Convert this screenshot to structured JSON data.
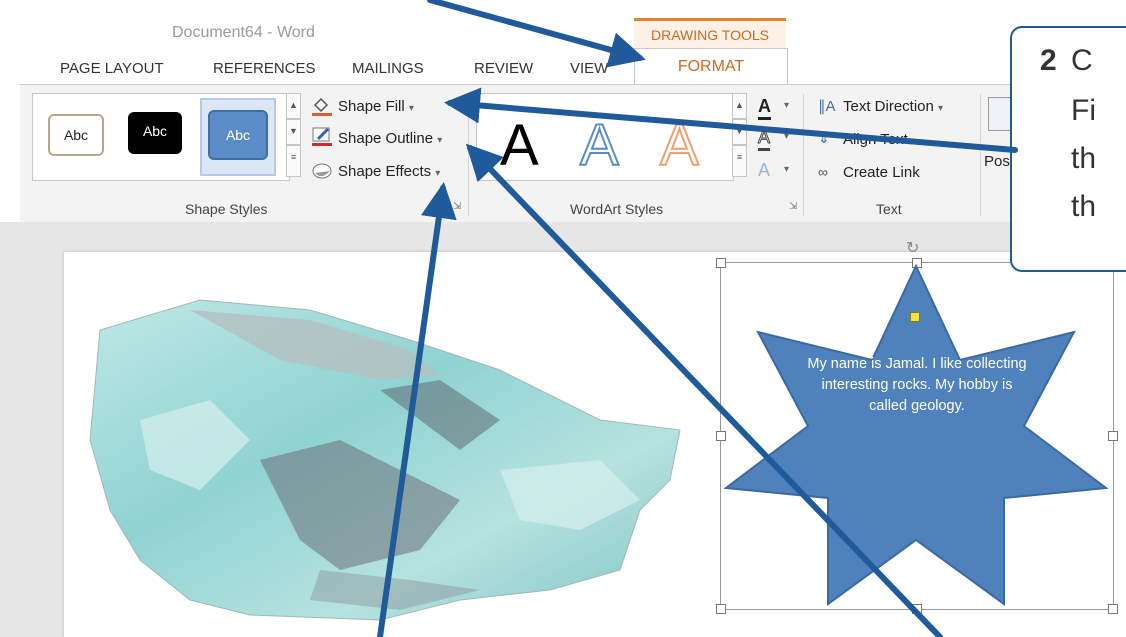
{
  "window": {
    "title": "Document64 - Word"
  },
  "contextual_tab": {
    "label": "DRAWING TOOLS"
  },
  "tabs": [
    {
      "label": "PAGE LAYOUT"
    },
    {
      "label": "REFERENCES"
    },
    {
      "label": "MAILINGS"
    },
    {
      "label": "REVIEW"
    },
    {
      "label": "VIEW"
    },
    {
      "label": "FORMAT"
    }
  ],
  "shape_styles": {
    "gallery": [
      {
        "label": "Abc",
        "style": "outline"
      },
      {
        "label": "Abc",
        "style": "black"
      },
      {
        "label": "Abc",
        "style": "blue-selected"
      }
    ],
    "shape_fill": "Shape Fill",
    "shape_outline": "Shape Outline",
    "shape_effects": "Shape Effects",
    "group_label": "Shape Styles"
  },
  "wordart_styles": {
    "glyphs": [
      "A",
      "A",
      "A"
    ],
    "group_label": "WordArt Styles"
  },
  "text_group": {
    "text_direction": "Text Direction",
    "align_text": "Align Text",
    "create_link": "Create Link",
    "group_label": "Text"
  },
  "arrange_group": {
    "position_label": "Positi"
  },
  "callout": {
    "number": "2",
    "lines": [
      "C",
      "Fi",
      "th",
      "th"
    ]
  },
  "document": {
    "star_text": "My name is Jamal. I like collecting interesting rocks. My hobby is called geology."
  },
  "colors": {
    "contextual_accent": "#d2691e",
    "shape_blue": "#4f81bd",
    "arrow_blue": "#1f5a9a"
  }
}
